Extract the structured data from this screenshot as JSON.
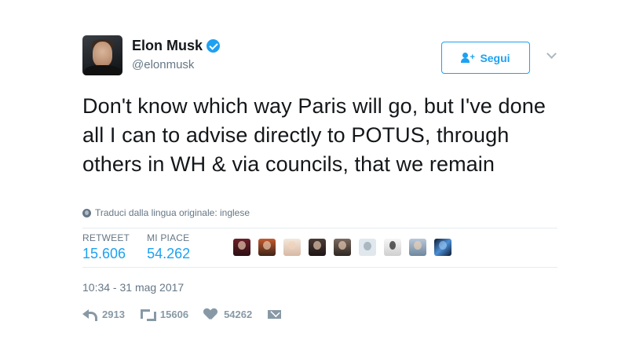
{
  "author": {
    "display_name": "Elon Musk",
    "username": "@elonmusk",
    "verified": true,
    "avatar_icon": "user-avatar"
  },
  "follow_button": {
    "label": "Segui",
    "icon": "add-user-icon"
  },
  "tweet": {
    "text": "Don't know which way Paris will go, but I've done all I can to advise directly to POTUS, through others in WH & via councils, that we remain",
    "translate_label": "Traduci dalla lingua originale: inglese"
  },
  "stats": {
    "retweet_label": "RETWEET",
    "retweet_value": "15.606",
    "likes_label": "MI PIACE",
    "likes_value": "54.262"
  },
  "likers_count_shown": 9,
  "timestamp": "10:34 - 31 mag 2017",
  "actions": {
    "reply_count": "2913",
    "retweet_count": "15606",
    "like_count": "54262"
  },
  "colors": {
    "accent": "#1da1f2",
    "text": "#14171a",
    "muted": "#657786",
    "action_gray": "#8899a6",
    "divider": "#e6ecf0"
  }
}
